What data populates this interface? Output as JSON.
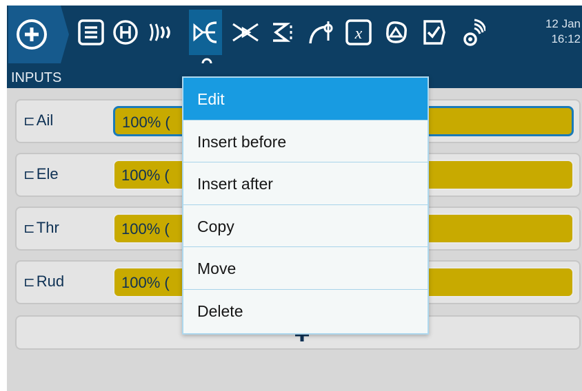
{
  "toolbar": {
    "icons": [
      "home-icon",
      "list-icon",
      "heli-icon",
      "flight-modes-icon",
      "inputs-icon",
      "mixer-icon",
      "outputs-icon",
      "curves-icon",
      "global-variables-icon",
      "logical-switches-icon",
      "special-functions-icon",
      "telemetry-icon"
    ],
    "active_icon": "inputs-icon",
    "date": "12 Jan",
    "time": "16:12"
  },
  "section": {
    "title": "INPUTS"
  },
  "inputs": [
    {
      "name": "Ail",
      "value": "100% ("
    },
    {
      "name": "Ele",
      "value": "100% ("
    },
    {
      "name": "Thr",
      "value": "100% ("
    },
    {
      "name": "Rud",
      "value": "100% ("
    }
  ],
  "input_glyph": "⊏",
  "add_label": "+",
  "menu": {
    "items": [
      "Edit",
      "Insert before",
      "Insert after",
      "Copy",
      "Move",
      "Delete"
    ],
    "selected": "Edit"
  },
  "colors": {
    "toolbar_bg": "#0d3e63",
    "active_tab": "#0f6397",
    "bar_fill": "#c8aa00",
    "menu_highlight": "#189be1",
    "menu_bg": "#f4f8f8"
  }
}
